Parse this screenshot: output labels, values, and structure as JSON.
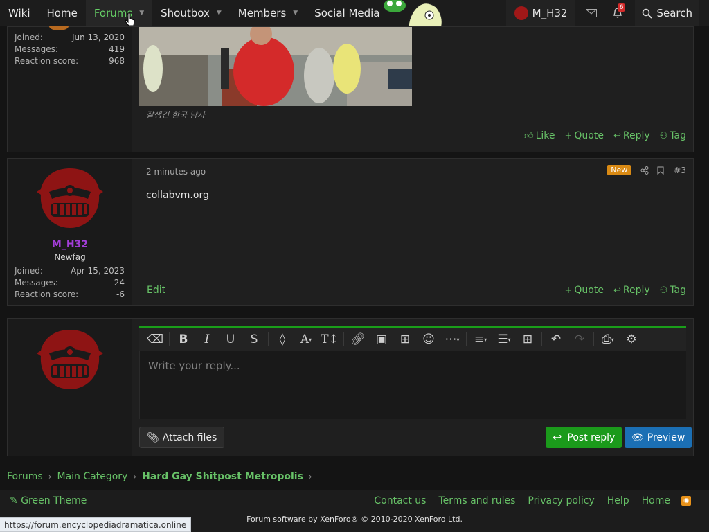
{
  "nav": {
    "items": [
      {
        "label": "Wiki"
      },
      {
        "label": "Home"
      },
      {
        "label": "Forums"
      },
      {
        "label": "Shoutbox"
      },
      {
        "label": "Members"
      },
      {
        "label": "Social Media"
      }
    ],
    "username": "M_H32",
    "alert_count": "6",
    "search_label": "Search"
  },
  "post1": {
    "stats": [
      {
        "key": "Joined:",
        "value": "Jun 13, 2020"
      },
      {
        "key": "Messages:",
        "value": "419"
      },
      {
        "key": "Reaction score:",
        "value": "968"
      }
    ],
    "caption": "잘생긴 한국 남자",
    "actions": {
      "like": "Like",
      "quote": "Quote",
      "reply": "Reply",
      "tag": "Tag"
    }
  },
  "post2": {
    "username": "M_H32",
    "title": "Newfag",
    "time": "2 minutes ago",
    "new_badge": "New",
    "number": "#3",
    "content": "collabvm.org",
    "stats": [
      {
        "key": "Joined:",
        "value": "Apr 15, 2023"
      },
      {
        "key": "Messages:",
        "value": "24"
      },
      {
        "key": "Reaction score:",
        "value": "-6"
      }
    ],
    "edit": "Edit",
    "actions": {
      "quote": "Quote",
      "reply": "Reply",
      "tag": "Tag"
    }
  },
  "editor": {
    "placeholder": "Write your reply...",
    "attach": "Attach files",
    "post_reply": "Post reply",
    "preview": "Preview"
  },
  "breadcrumb": [
    "Forums",
    "Main Category",
    "Hard Gay Shitpost Metropolis"
  ],
  "footer": {
    "theme": "Green Theme",
    "links": [
      "Contact us",
      "Terms and rules",
      "Privacy policy",
      "Help",
      "Home"
    ],
    "copyright": "Forum software by XenForo® © 2010-2020 XenForo Ltd."
  },
  "status_url": "https://forum.encyclopediadramatica.online",
  "colors": {
    "accent": "#67c167",
    "username": "#a23dd8",
    "crest": "#8e1414",
    "post_button": "#1b9a1b",
    "preview_button": "#1b6fb4"
  }
}
